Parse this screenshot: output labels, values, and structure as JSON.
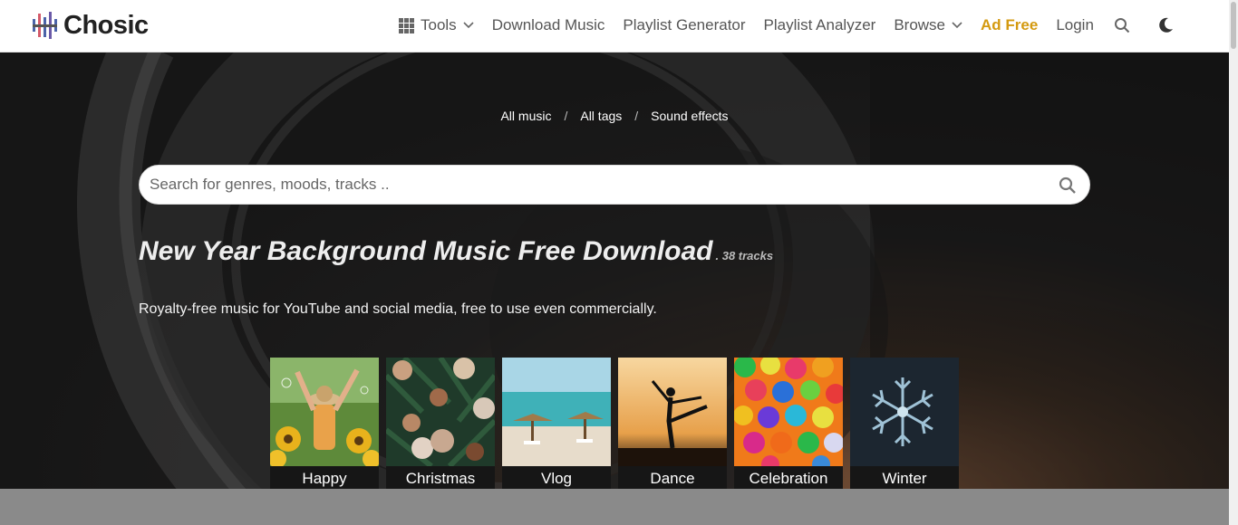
{
  "header": {
    "logo_text": "Chosic",
    "nav": {
      "tools": "Tools",
      "download_music": "Download Music",
      "playlist_generator": "Playlist Generator",
      "playlist_analyzer": "Playlist Analyzer",
      "browse": "Browse",
      "ad_free": "Ad Free",
      "login": "Login"
    }
  },
  "breadcrumbs": {
    "all_music": "All music",
    "all_tags": "All tags",
    "sound_effects": "Sound effects",
    "separator": "/"
  },
  "search": {
    "placeholder": "Search for genres, moods, tracks .."
  },
  "page": {
    "title": "New Year Background Music Free Download",
    "track_count": ". 38 tracks",
    "subtitle": "Royalty-free music for YouTube and social media, free to use even commercially."
  },
  "tiles": [
    {
      "label": "Happy"
    },
    {
      "label": "Christmas"
    },
    {
      "label": "Vlog"
    },
    {
      "label": "Dance"
    },
    {
      "label": "Celebration"
    },
    {
      "label": "Winter"
    }
  ],
  "colors": {
    "accent_ad_free": "#d49a10",
    "hero_dark": "#161616"
  }
}
